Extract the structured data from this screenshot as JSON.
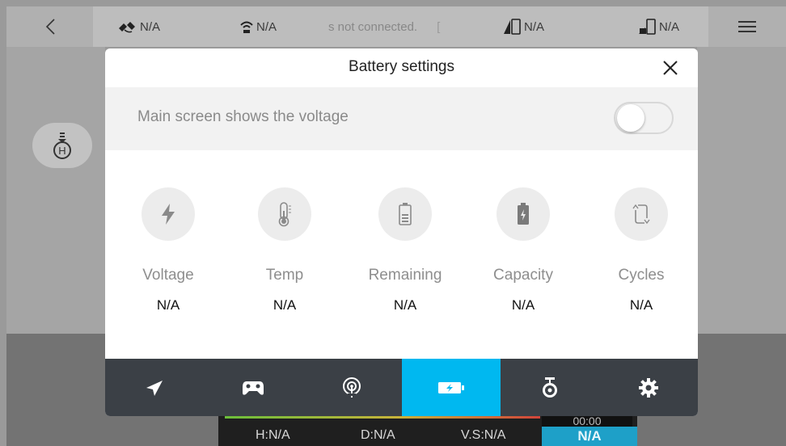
{
  "topbar": {
    "gps": "N/A",
    "link": "N/A",
    "message": "s not connected.",
    "message_tail": "[",
    "rc_signal": "N/A",
    "battery": "N/A"
  },
  "modal": {
    "title": "Battery settings",
    "toggle_label": "Main screen shows the voltage",
    "toggle_on": false,
    "metrics": [
      {
        "label": "Voltage",
        "value": "N/A",
        "icon": "lightning-icon"
      },
      {
        "label": "Temp",
        "value": "N/A",
        "icon": "thermometer-icon"
      },
      {
        "label": "Remaining",
        "value": "N/A",
        "icon": "battery-level-icon"
      },
      {
        "label": "Capacity",
        "value": "N/A",
        "icon": "battery-charge-icon"
      },
      {
        "label": "Cycles",
        "value": "N/A",
        "icon": "cycle-icon"
      }
    ],
    "tabs": [
      {
        "name": "flight",
        "icon": "paper-plane-icon",
        "active": false
      },
      {
        "name": "controller",
        "icon": "gamepad-icon",
        "active": false
      },
      {
        "name": "signal",
        "icon": "antenna-icon",
        "active": false
      },
      {
        "name": "battery",
        "icon": "battery-icon",
        "active": true
      },
      {
        "name": "gimbal",
        "icon": "gimbal-icon",
        "active": false
      },
      {
        "name": "settings",
        "icon": "gear-icon",
        "active": false
      }
    ]
  },
  "hud": {
    "timer": "00:00",
    "height": "H:N/A",
    "distance": "D:N/A",
    "vspeed": "V.S:N/A",
    "speed": "N/A"
  },
  "colors": {
    "accent": "#00b8f0",
    "tabbar": "#3b4046"
  }
}
